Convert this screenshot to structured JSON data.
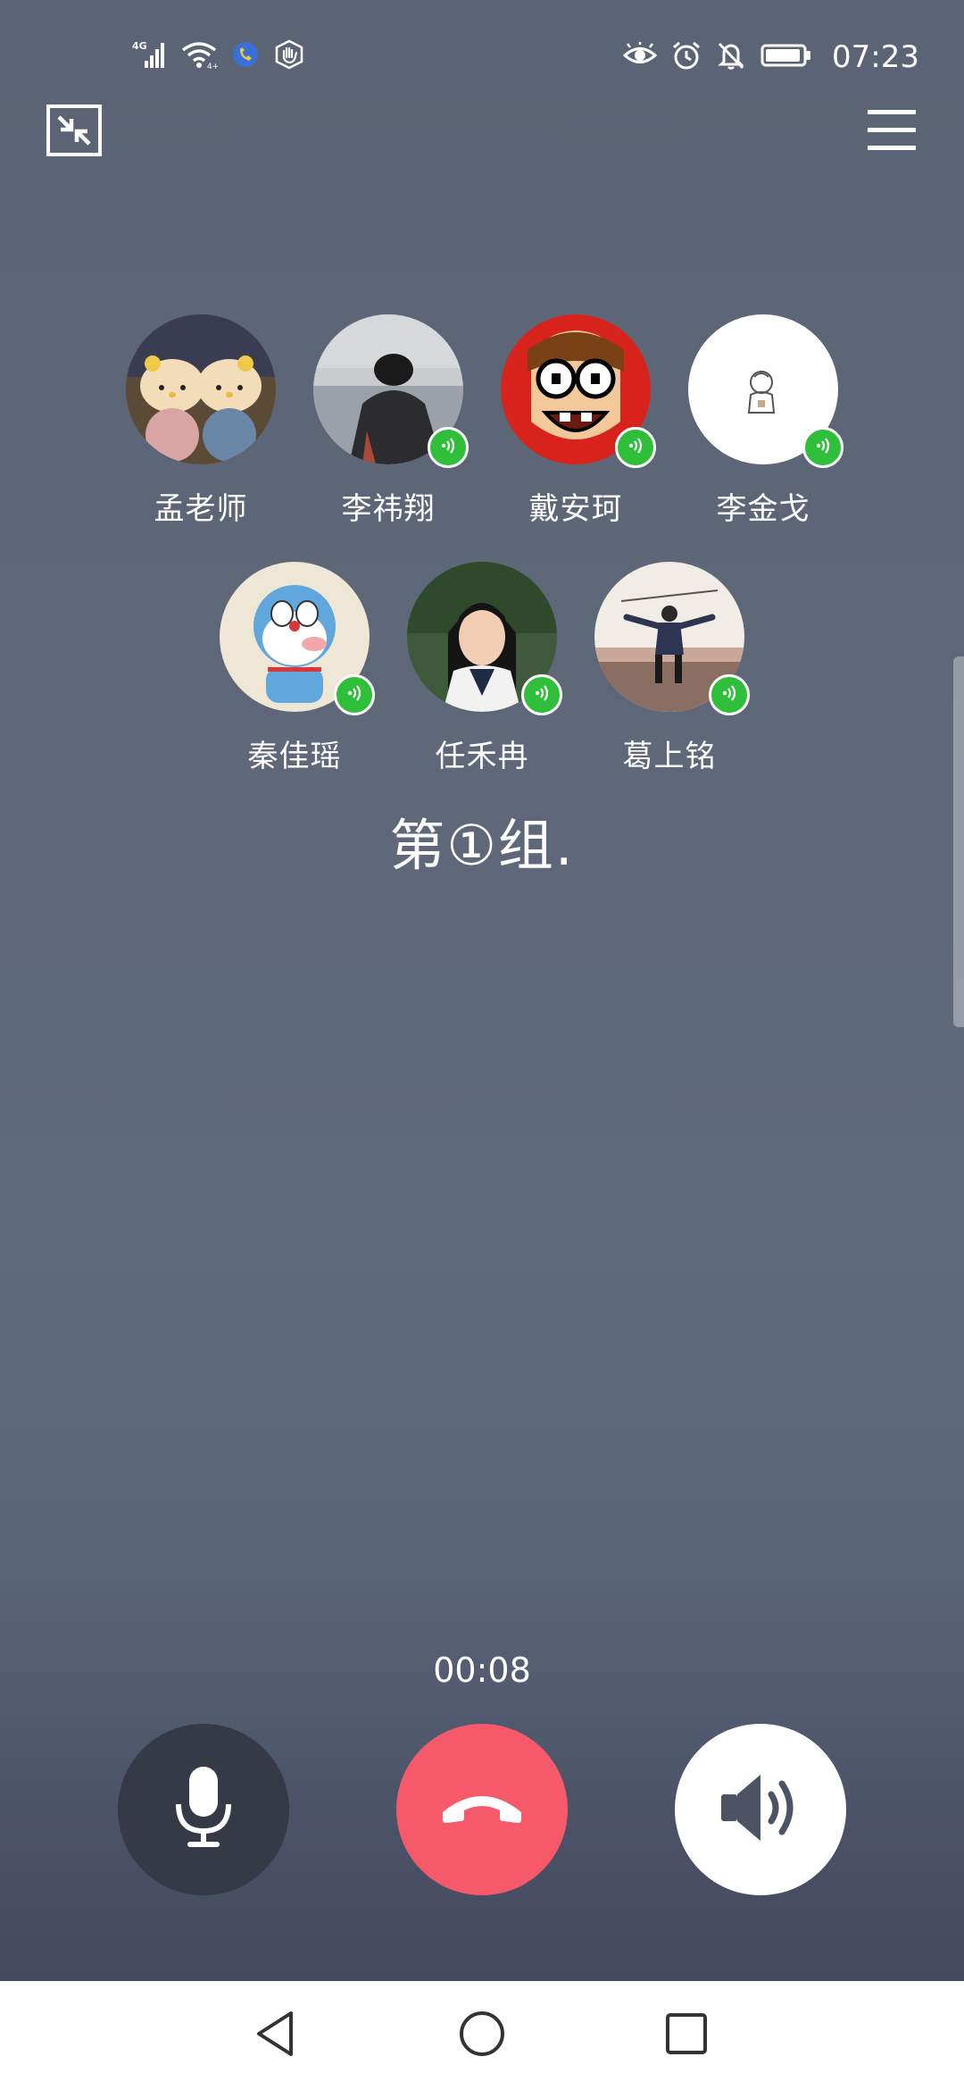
{
  "status_bar": {
    "network_type": "4G",
    "time": "07:23",
    "icons": [
      "signal-icon",
      "wifi-icon",
      "call-indicator-icon",
      "hand-icon",
      "eye-icon",
      "alarm-icon",
      "mute-bell-icon",
      "battery-icon"
    ]
  },
  "top_bar": {
    "left_icon": "exit-fullscreen-icon",
    "right_icon": "menu-icon"
  },
  "participants": [
    {
      "name": "孟老师",
      "speaking": false
    },
    {
      "name": "李祎翔",
      "speaking": true
    },
    {
      "name": "戴安珂",
      "speaking": true
    },
    {
      "name": "李金戈",
      "speaking": true
    },
    {
      "name": "秦佳瑶",
      "speaking": true
    },
    {
      "name": "任禾冉",
      "speaking": true
    },
    {
      "name": "葛上铭",
      "speaking": true
    }
  ],
  "group_title": "第①组.",
  "call": {
    "duration": "00:08",
    "controls": [
      {
        "icon": "microphone-icon",
        "state": "on"
      },
      {
        "icon": "hang-up-icon",
        "color": "#f65a6a"
      },
      {
        "icon": "speaker-icon",
        "state": "on"
      }
    ]
  },
  "nav_bar": {
    "icons": [
      "back-icon",
      "home-icon",
      "recents-icon"
    ]
  },
  "colors": {
    "speaking_badge": "#2fbf3a",
    "hang_up": "#f65a6a",
    "mic_button": "#353a46"
  }
}
